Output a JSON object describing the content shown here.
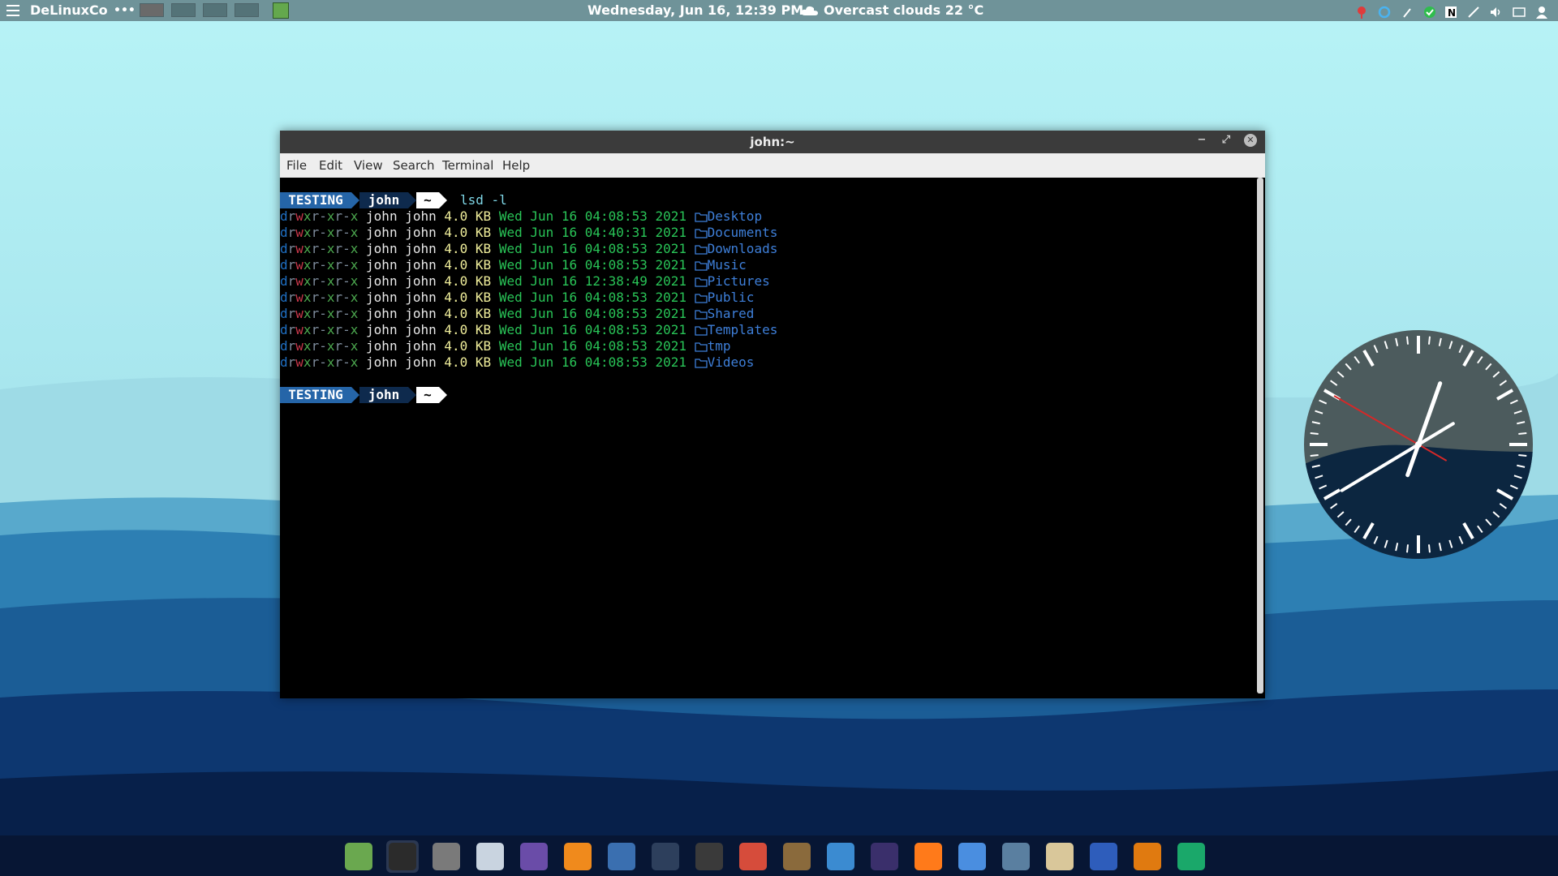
{
  "top_panel": {
    "app_menu_icon": "hamburger-menu-icon",
    "brand": "DeLinuxCo",
    "overflow": "•••",
    "workspaces": 4,
    "datetime": "Wednesday, Jun 16, 12:39 PM",
    "weather_icon": "cloud-icon",
    "weather": "Overcast clouds 22 °C",
    "tray_icons": [
      "red-pin-icon",
      "refresh-icon",
      "paperclip-icon",
      "green-check-icon",
      "notion-icon",
      "wand-icon",
      "volume-icon",
      "keyboard-icon",
      "user-icon"
    ]
  },
  "window": {
    "title": "john:~",
    "controls": {
      "minimize": "−",
      "maximize": "⤢",
      "close": "✕"
    },
    "menu": [
      "File",
      "Edit",
      "View",
      "Search",
      "Terminal",
      "Help"
    ]
  },
  "terminal": {
    "prompt": {
      "env": "TESTING",
      "user": "john",
      "dir": "~"
    },
    "command": "lsd -l",
    "permissions": "drwxr-xr-x",
    "owner": "john",
    "group": "john",
    "size": "4.0 KB",
    "folder_icon": "folder-icon",
    "entries": [
      {
        "date": "Wed Jun 16 04:08:53 2021",
        "name": "Desktop"
      },
      {
        "date": "Wed Jun 16 04:40:31 2021",
        "name": "Documents"
      },
      {
        "date": "Wed Jun 16 04:08:53 2021",
        "name": "Downloads"
      },
      {
        "date": "Wed Jun 16 04:08:53 2021",
        "name": "Music"
      },
      {
        "date": "Wed Jun 16 12:38:49 2021",
        "name": "Pictures"
      },
      {
        "date": "Wed Jun 16 04:08:53 2021",
        "name": "Public"
      },
      {
        "date": "Wed Jun 16 04:08:53 2021",
        "name": "Shared"
      },
      {
        "date": "Wed Jun 16 04:08:53 2021",
        "name": "Templates"
      },
      {
        "date": "Wed Jun 16 04:08:53 2021",
        "name": "tmp"
      },
      {
        "date": "Wed Jun 16 04:08:53 2021",
        "name": "Videos"
      }
    ]
  },
  "clock_widget": {
    "hours": 12,
    "minutes": 39,
    "seconds": 50
  },
  "dock": {
    "items": [
      "home-folder-icon",
      "terminal-icon",
      "calculator-icon",
      "image-viewer-icon",
      "audio-player-icon",
      "blender-icon",
      "video-editor-icon",
      "audio-editor-icon",
      "camera-icon",
      "color-picker-icon",
      "gimp-icon",
      "bluefish-icon",
      "inkscape-icon",
      "firefox-icon",
      "chromium-icon",
      "mail-icon",
      "notes-icon",
      "word-processor-icon",
      "presentation-icon",
      "calc-icon"
    ],
    "active": 1
  },
  "colors": {
    "panel": "#6f9399",
    "dock": "#071634",
    "prompt_env": "#2565a8",
    "prompt_user": "#0e2a4d",
    "folder": "#3e7fd9"
  }
}
